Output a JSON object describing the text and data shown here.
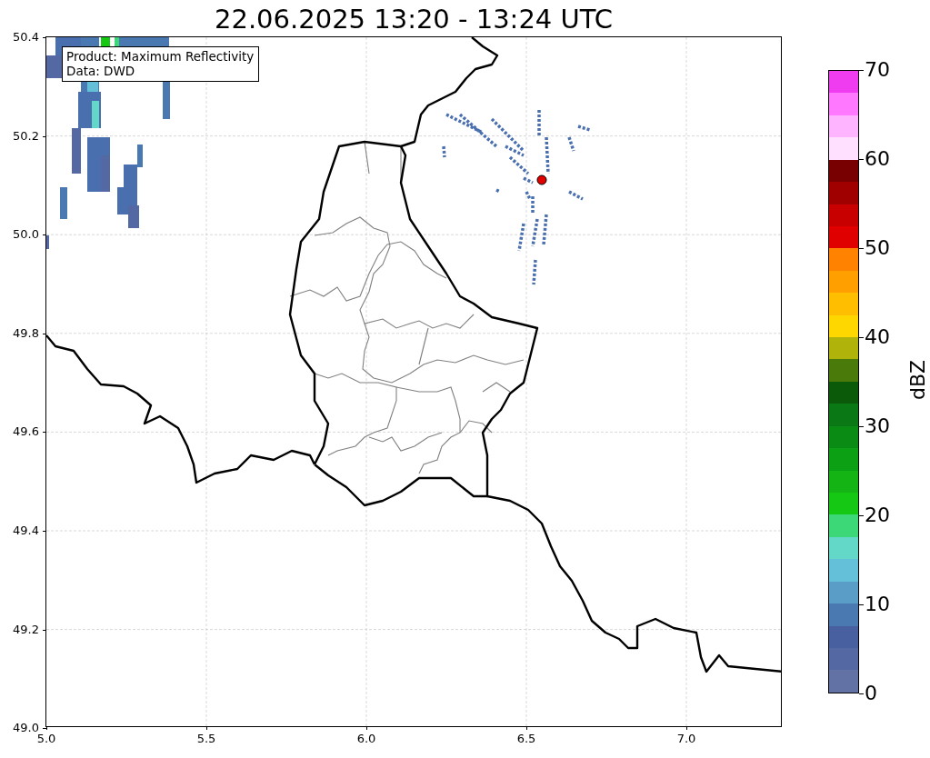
{
  "title": "22.06.2025 13:20 - 13:24 UTC",
  "legend": [
    "Product: Maximum Reflectivity",
    "Data: DWD"
  ],
  "map": {
    "x_ticks": [
      "5.0",
      "5.5",
      "6.0",
      "6.5",
      "7.0"
    ],
    "y_ticks": [
      "50.4",
      "50.2",
      "50.0",
      "49.8",
      "49.6",
      "49.4",
      "49.2",
      "49.0"
    ]
  },
  "colorbar": {
    "label": "dBZ",
    "ticks": [
      "70",
      "60",
      "50",
      "40",
      "30",
      "20",
      "10",
      "0"
    ],
    "bins": [
      {
        "color": "#f03cf0"
      },
      {
        "color": "#ff78ff"
      },
      {
        "color": "#ffb4ff"
      },
      {
        "color": "#ffe0ff"
      },
      {
        "color": "#780000"
      },
      {
        "color": "#a00000"
      },
      {
        "color": "#c80000"
      },
      {
        "color": "#e10000"
      },
      {
        "color": "#ff8200"
      },
      {
        "color": "#ffa000"
      },
      {
        "color": "#ffbe00"
      },
      {
        "color": "#ffd700"
      },
      {
        "color": "#b0b40a"
      },
      {
        "color": "#4a7a0a"
      },
      {
        "color": "#0a5a0a"
      },
      {
        "color": "#0a7814"
      },
      {
        "color": "#0a8c14"
      },
      {
        "color": "#0ca014"
      },
      {
        "color": "#14b414"
      },
      {
        "color": "#14c814"
      },
      {
        "color": "#3cd878"
      },
      {
        "color": "#64d8c8"
      },
      {
        "color": "#64c0d8"
      },
      {
        "color": "#5a9ec8"
      },
      {
        "color": "#4a78b0"
      },
      {
        "color": "#4860a0"
      },
      {
        "color": "#5468a4"
      },
      {
        "color": "#6272a4"
      }
    ]
  }
}
